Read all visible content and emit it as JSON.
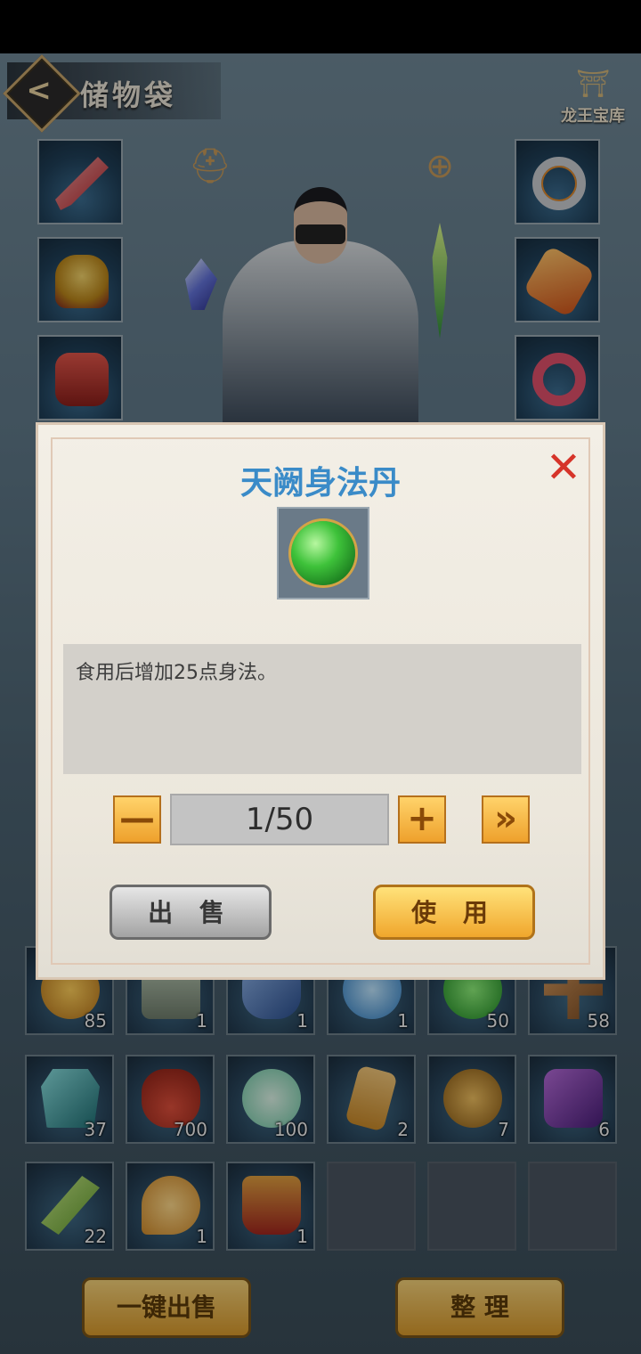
{
  "header": {
    "back_label": "<",
    "title": "储物袋",
    "treasure_label": "龙王宝库"
  },
  "equipment": {
    "left": [
      "sword",
      "helmet",
      "armor"
    ],
    "right": [
      "ring",
      "amulet",
      "bracelet"
    ]
  },
  "inventory": {
    "rows": [
      [
        {
          "icon": "gold-orb",
          "count": "85"
        },
        {
          "icon": "stone-tablet",
          "count": "1"
        },
        {
          "icon": "blue-fish",
          "count": "1"
        },
        {
          "icon": "water-orb",
          "count": "1"
        },
        {
          "icon": "jade-orb",
          "count": "50"
        },
        {
          "icon": "wood-cross",
          "count": "58"
        }
      ],
      [
        {
          "icon": "teal-crystal",
          "count": "37"
        },
        {
          "icon": "grain-bag",
          "count": "700"
        },
        {
          "icon": "jade-cloud",
          "count": "100"
        },
        {
          "icon": "talisman",
          "count": "2"
        },
        {
          "icon": "bronze-bell",
          "count": "7"
        },
        {
          "icon": "purple-seal",
          "count": "6"
        }
      ],
      [
        {
          "icon": "green-leaf",
          "count": "22"
        },
        {
          "icon": "gold-pendant",
          "count": "1"
        },
        {
          "icon": "red-boots",
          "count": "1"
        },
        {
          "icon": "empty",
          "count": ""
        },
        {
          "icon": "empty",
          "count": ""
        },
        {
          "icon": "empty",
          "count": ""
        }
      ]
    ]
  },
  "bottom": {
    "sell_all_label": "一键出售",
    "sort_label": "整 理"
  },
  "dialog": {
    "title": "天阙身法丹",
    "close_label": "✕",
    "description": "食用后增加25点身法。",
    "quantity": "1/50",
    "minus_label": "—",
    "plus_label": "+",
    "max_label": "»",
    "sell_label": "出 售",
    "use_label": "使 用"
  },
  "colors": {
    "title_blue": "#3a8bc8",
    "close_red": "#d6342a",
    "gold_button": "#f0a62c"
  }
}
